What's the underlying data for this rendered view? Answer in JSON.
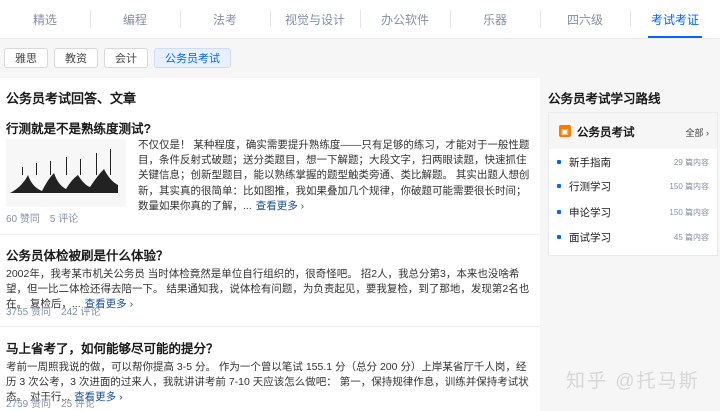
{
  "top_tabs": [
    "精选",
    "编程",
    "法考",
    "视觉与设计",
    "办公软件",
    "乐器",
    "四六级",
    "考试考证"
  ],
  "sub_tabs": [
    "雅思",
    "教资",
    "会计",
    "公务员考试"
  ],
  "main": {
    "section_title": "公务员考试回答、文章",
    "items": [
      {
        "title": "行测就是不是熟练度测试?",
        "excerpt": "不仅仅是！ 某种程度，确实需要提升熟练度——只有足够的练习，才能对于一般性题目，条件反射式破题；送分类题目，想一下解题；大段文字，扫两眼读题，快速抓住关键信息；创新型题目，能以熟练掌握的题型触类旁通、类比解题。 其实出题人想创新，其实真的很简单：比如图推，我如果叠加几个规律，你破题可能需要很长时间；数量如果你真的了解，...",
        "more": "查看更多 ›",
        "upvotes": "60 赞同",
        "comments": "5 评论"
      },
      {
        "title": "公务员体检被刷是什么体验？",
        "excerpt": "2002年，我考某市机关公务员 当时体检竟然是单位自行组织的，很奇怪吧。 招2人，我总分第3，本来也没啥希望，但一比二体检还得去陪一下。 结果通知我，说体检有问题，为负责起见，要我复检，到了那地，发现第2名也在。 复检后，...",
        "more": "查看更多 ›",
        "upvotes": "3755 赞同",
        "comments": "242 评论"
      },
      {
        "title": "马上省考了，如何能够尽可能的提分？",
        "excerpt": "考前一周照我说的做，可以帮你提高 3-5 分。 作为一个曾以笔试 155.1 分（总分 200 分）上岸某省厅千人岗，经历 3 次公考，3 次进面的过来人，我就讲讲考前 7-10 天应该怎么做吧： 第一，保持规律作息，训练并保持考试状态。 对于行...",
        "more": "查看更多 ›",
        "upvotes": "2759 赞同",
        "comments": "25 评论"
      }
    ]
  },
  "sidebar": {
    "title": "公务员考试学习路线",
    "card_icon": "exam-badge-icon",
    "card_name": "公务员考试",
    "all_label": "全部 ›",
    "paths": [
      {
        "name": "新手指南",
        "count": "29 篇内容"
      },
      {
        "name": "行测学习",
        "count": "150 篇内容"
      },
      {
        "name": "申论学习",
        "count": "150 篇内容"
      },
      {
        "name": "面试学习",
        "count": "45 篇内容"
      }
    ]
  },
  "watermark": "知乎 @托马斯",
  "colors": {
    "accent": "#0066ff",
    "link": "#175199",
    "badge": "#ff7a00",
    "muted": "#8590a6"
  }
}
